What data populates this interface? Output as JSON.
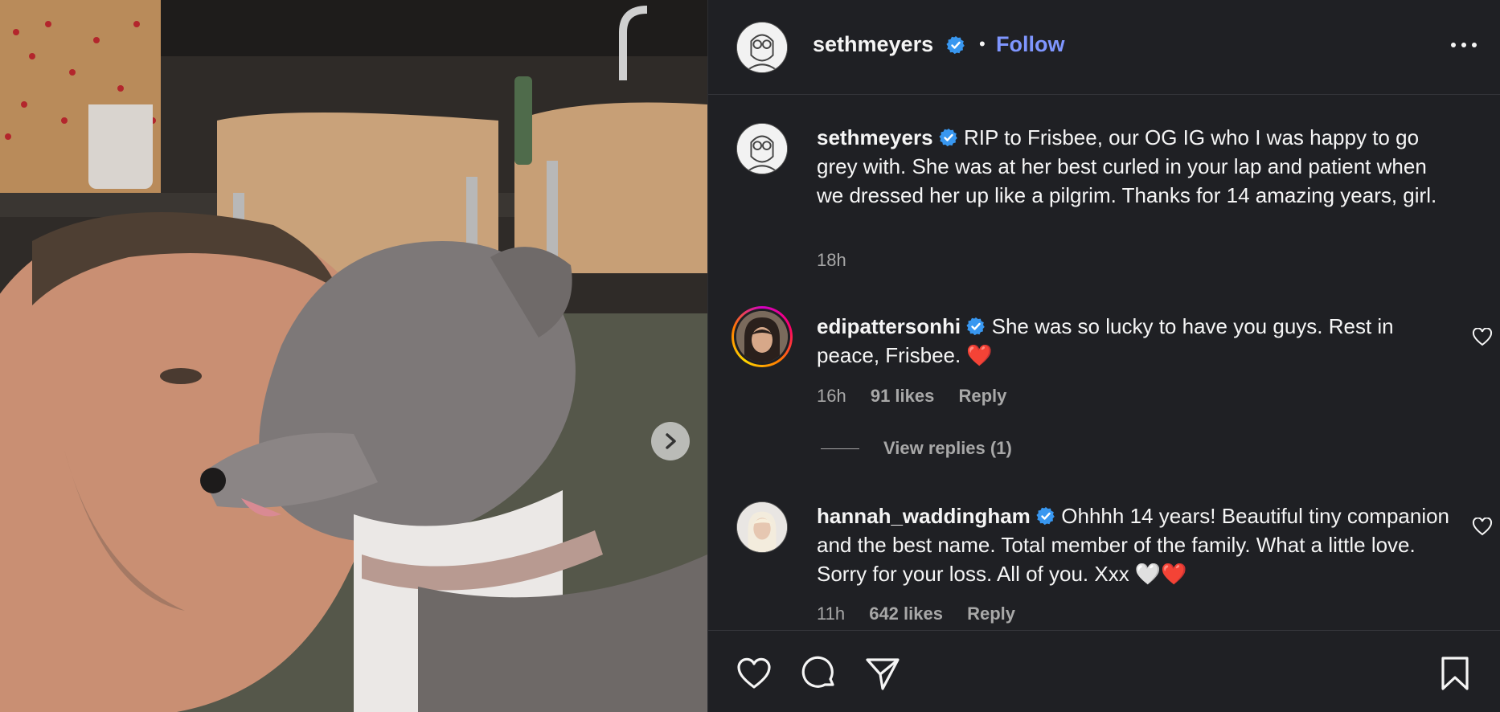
{
  "post": {
    "username": "sethmeyers",
    "separator": "•",
    "follow_label": "Follow"
  },
  "caption": {
    "username": "sethmeyers",
    "text": "RIP to Frisbee, our OG IG who I was happy to go grey with. She was at her best curled in your lap and patient when we dressed her up like a pilgrim. Thanks for 14 amazing years, girl.",
    "time": "18h"
  },
  "comments": [
    {
      "username": "edipattersonhi",
      "text": "She was so lucky to have you guys. Rest in peace, Frisbee. ❤️",
      "time": "16h",
      "likes": "91 likes",
      "reply_label": "Reply"
    },
    {
      "username": "hannah_waddingham",
      "text": "Ohhhh 14 years! Beautiful tiny companion and the best name. Total member of the family. What a little love. Sorry for your loss. All of you. Xxx 🤍❤️",
      "time": "11h",
      "likes": "642 likes",
      "reply_label": "Reply"
    }
  ],
  "view_replies_label": "View replies (1)",
  "colors": {
    "follow": "#7f96ff",
    "verified": "#3897f0",
    "panel_bg": "#1f2024",
    "muted_text": "#a8a8a8"
  },
  "icons": [
    "chevron-right-icon",
    "more-icon",
    "verified-icon",
    "heart-icon",
    "comment-icon",
    "share-icon",
    "bookmark-icon"
  ]
}
